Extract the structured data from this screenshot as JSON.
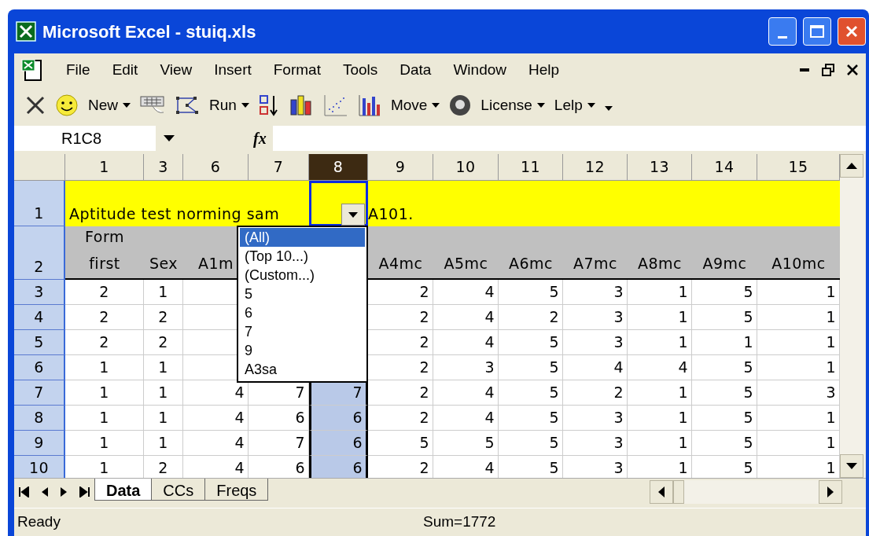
{
  "window": {
    "title": "Microsoft Excel - stuiq.xls"
  },
  "menu_bar": [
    "File",
    "Edit",
    "View",
    "Insert",
    "Format",
    "Tools",
    "Data",
    "Window",
    "Help"
  ],
  "toolbar": {
    "buttons": [
      {
        "label": "New"
      },
      {
        "label": "Run"
      },
      {
        "label": "Move"
      },
      {
        "label": "License"
      },
      {
        "label": "Lelp"
      }
    ]
  },
  "name_box": {
    "value": "R1C8"
  },
  "formula_bar": {
    "function_label": "fx"
  },
  "columns": [
    {
      "label": "1",
      "selected": false
    },
    {
      "label": "3",
      "selected": false
    },
    {
      "label": "6",
      "selected": false
    },
    {
      "label": "7",
      "selected": false
    },
    {
      "label": "8",
      "selected": true
    },
    {
      "label": "9",
      "selected": false
    },
    {
      "label": "10",
      "selected": false
    },
    {
      "label": "11",
      "selected": false
    },
    {
      "label": "12",
      "selected": false
    },
    {
      "label": "13",
      "selected": false
    },
    {
      "label": "14",
      "selected": false
    },
    {
      "label": "15",
      "selected": false
    }
  ],
  "rows": [
    {
      "header": "1",
      "kind": "title",
      "title": "Aptitude test norming sam",
      "note": "A101."
    },
    {
      "header": "2",
      "kind": "labels",
      "cells": [
        "Form first",
        "Sex",
        "A1m",
        null,
        null,
        "A4mc",
        "A5mc",
        "A6mc",
        "A7mc",
        "A8mc",
        "A9mc",
        "A10mc"
      ]
    },
    {
      "header": "3",
      "kind": "data",
      "cells": [
        "2",
        "1",
        null,
        null,
        null,
        "2",
        "4",
        "5",
        "3",
        "1",
        "5",
        "1"
      ]
    },
    {
      "header": "4",
      "kind": "data",
      "cells": [
        "2",
        "2",
        null,
        null,
        null,
        "2",
        "4",
        "2",
        "3",
        "1",
        "5",
        "1"
      ]
    },
    {
      "header": "5",
      "kind": "data",
      "cells": [
        "2",
        "2",
        null,
        null,
        null,
        "2",
        "4",
        "5",
        "3",
        "1",
        "1",
        "1"
      ]
    },
    {
      "header": "6",
      "kind": "data",
      "cells": [
        "1",
        "1",
        null,
        null,
        null,
        "2",
        "3",
        "5",
        "4",
        "4",
        "5",
        "1"
      ]
    },
    {
      "header": "7",
      "kind": "data",
      "cells": [
        "1",
        "1",
        "4",
        "7",
        "7",
        "2",
        "4",
        "5",
        "2",
        "1",
        "5",
        "3"
      ]
    },
    {
      "header": "8",
      "kind": "data",
      "cells": [
        "1",
        "1",
        "4",
        "6",
        "6",
        "2",
        "4",
        "5",
        "3",
        "1",
        "5",
        "1"
      ]
    },
    {
      "header": "9",
      "kind": "data",
      "cells": [
        "1",
        "1",
        "4",
        "7",
        "6",
        "5",
        "5",
        "5",
        "3",
        "1",
        "5",
        "1"
      ]
    },
    {
      "header": "10",
      "kind": "data",
      "cells": [
        "1",
        "2",
        "4",
        "6",
        "6",
        "2",
        "4",
        "5",
        "3",
        "1",
        "5",
        "1"
      ]
    }
  ],
  "filter_dropdown": {
    "items": [
      {
        "label": "(All)",
        "selected": true
      },
      {
        "label": "(Top 10...)",
        "selected": false
      },
      {
        "label": "(Custom...)",
        "selected": false
      },
      {
        "label": "5",
        "selected": false
      },
      {
        "label": "6",
        "selected": false
      },
      {
        "label": "7",
        "selected": false
      },
      {
        "label": "9",
        "selected": false
      },
      {
        "label": "A3sa",
        "selected": false
      }
    ]
  },
  "sheet_tabs": [
    {
      "label": "Data",
      "selected": true
    },
    {
      "label": "CCs",
      "selected": false
    },
    {
      "label": "Freqs",
      "selected": false
    }
  ],
  "status_bar": {
    "text": "Ready",
    "sum": "Sum=1772"
  }
}
